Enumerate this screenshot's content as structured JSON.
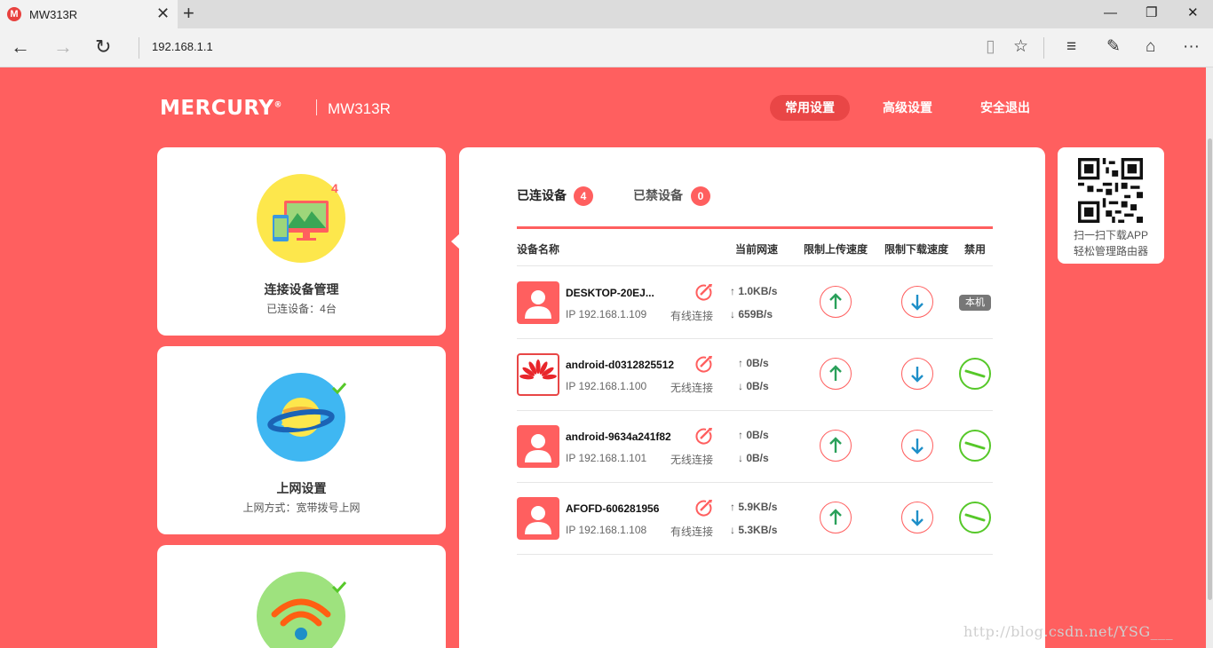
{
  "browser": {
    "tab_title": "MW313R",
    "favicon_letter": "M",
    "close_tab": "✕",
    "new_tab": "+",
    "address": "192.168.1.1",
    "window": {
      "minimize": "—",
      "restore": "❐",
      "close": "✕"
    },
    "nav": {
      "back": "←",
      "forward": "→",
      "refresh": "↻"
    },
    "tools": {
      "reading": "▯",
      "favorite": "☆",
      "hub": "≡",
      "note": "✎",
      "share": "⌂",
      "more": "···"
    }
  },
  "header": {
    "logo": "MERCURY",
    "trademark": "®",
    "model": "MW313R",
    "nav": [
      {
        "label": "常用设置",
        "active": true
      },
      {
        "label": "高级设置",
        "active": false
      },
      {
        "label": "安全退出",
        "active": false
      }
    ]
  },
  "cards": [
    {
      "title": "连接设备管理",
      "subtitle": "已连设备：4台",
      "badge": "4"
    },
    {
      "title": "上网设置",
      "subtitle": "上网方式：宽带拨号上网"
    },
    {
      "title": "",
      "subtitle": ""
    }
  ],
  "panel": {
    "tabs": [
      {
        "label": "已连设备",
        "count": "4"
      },
      {
        "label": "已禁设备",
        "count": "0"
      }
    ],
    "columns": [
      "设备名称",
      "当前网速",
      "限制上传速度",
      "限制下载速度",
      "禁用"
    ],
    "devices": [
      {
        "name": "DESKTOP-20EJ...",
        "ip": "IP 192.168.1.109",
        "conn": "有线连接",
        "up": "1.0KB/s",
        "down": "659B/s",
        "avatar": "user",
        "self": "本机"
      },
      {
        "name": "android-d0312825512",
        "ip": "IP 192.168.1.100",
        "conn": "无线连接",
        "up": "0B/s",
        "down": "0B/s",
        "avatar": "huawei"
      },
      {
        "name": "android-9634a241f82",
        "ip": "IP 192.168.1.101",
        "conn": "无线连接",
        "up": "0B/s",
        "down": "0B/s",
        "avatar": "user"
      },
      {
        "name": "AFOFD-606281956",
        "ip": "IP 192.168.1.108",
        "conn": "有线连接",
        "up": "5.9KB/s",
        "down": "5.3KB/s",
        "avatar": "user"
      }
    ]
  },
  "qr": {
    "line1": "扫一扫下载APP",
    "line2": "轻松管理路由器"
  },
  "watermark": "http://blog.csdn.net/YSG___",
  "colors": {
    "brand": "#ff5f5f",
    "ban": "#56c829",
    "up_arrow": "#2aa05a",
    "down_arrow": "#1e8fc8"
  }
}
